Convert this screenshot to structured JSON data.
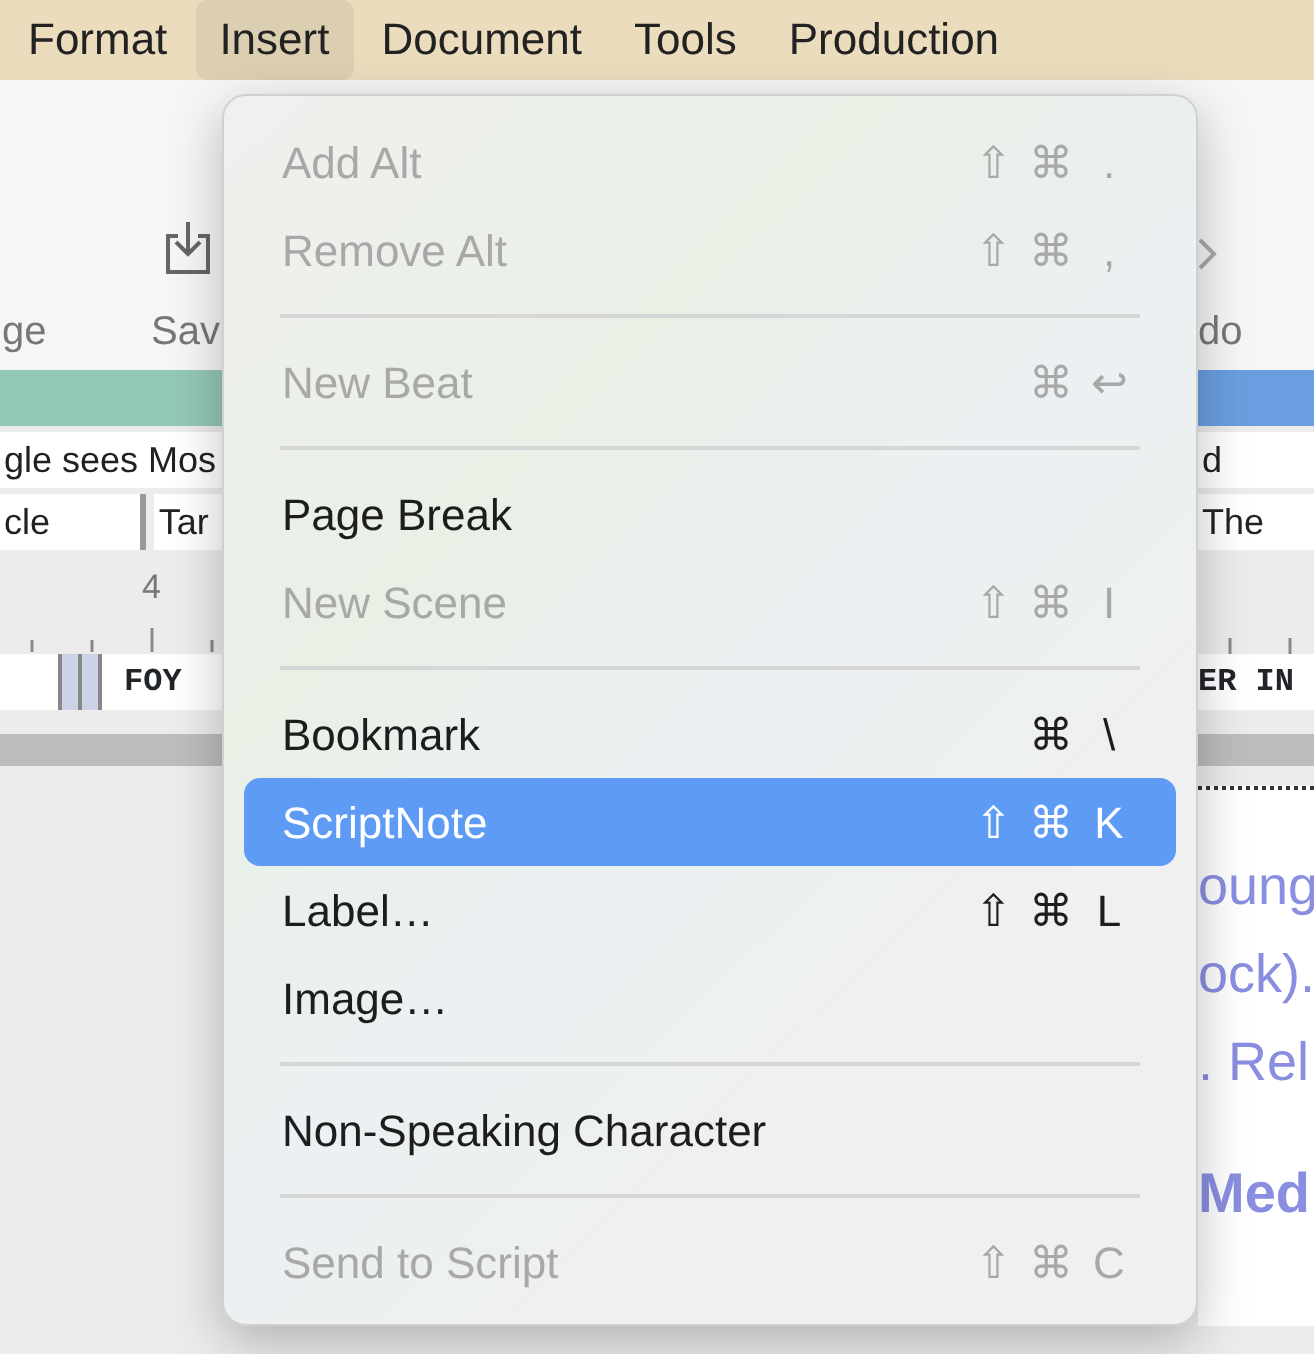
{
  "menu_bar": [
    {
      "label": "Format",
      "selected": false
    },
    {
      "label": "Insert",
      "selected": true
    },
    {
      "label": "Document",
      "selected": false
    },
    {
      "label": "Tools",
      "selected": false
    },
    {
      "label": "Production",
      "selected": false
    }
  ],
  "toolbar": {
    "left_labels": [
      "ge",
      "Sav"
    ],
    "right_label": "do"
  },
  "background": {
    "row_1": {
      "left": "gle sees Mos",
      "right": "d"
    },
    "row_2": {
      "left": [
        "cle",
        "Tar"
      ],
      "right": "The"
    },
    "ruler_number": "4",
    "script_row": {
      "left": "FOY",
      "right": "ER IN"
    },
    "document_lines": [
      "oung",
      "ock).",
      ". Rel"
    ],
    "document_heading": "Med"
  },
  "dropdown": [
    {
      "kind": "item",
      "label": "Add Alt",
      "shortcut": [
        "⇧",
        "⌘",
        "."
      ],
      "disabled": true,
      "selected": false
    },
    {
      "kind": "item",
      "label": "Remove Alt",
      "shortcut": [
        "⇧",
        "⌘",
        ","
      ],
      "disabled": true,
      "selected": false
    },
    {
      "kind": "separator"
    },
    {
      "kind": "item",
      "label": "New Beat",
      "shortcut": [
        "⌘",
        "↩"
      ],
      "disabled": true,
      "selected": false
    },
    {
      "kind": "separator"
    },
    {
      "kind": "item",
      "label": "Page Break",
      "disabled": false,
      "selected": false
    },
    {
      "kind": "item",
      "label": "New Scene",
      "shortcut": [
        "⇧",
        "⌘",
        "I"
      ],
      "disabled": true,
      "selected": false
    },
    {
      "kind": "separator"
    },
    {
      "kind": "item",
      "label": "Bookmark",
      "shortcut": [
        "⌘",
        "\\"
      ],
      "disabled": false,
      "selected": false
    },
    {
      "kind": "item",
      "label": "ScriptNote",
      "shortcut": [
        "⇧",
        "⌘",
        "K"
      ],
      "disabled": false,
      "selected": true
    },
    {
      "kind": "item",
      "label": "Label…",
      "shortcut": [
        "⇧",
        "⌘",
        "L"
      ],
      "disabled": false,
      "selected": false
    },
    {
      "kind": "item",
      "label": "Image…",
      "disabled": false,
      "selected": false
    },
    {
      "kind": "separator"
    },
    {
      "kind": "item",
      "label": "Non-Speaking Character",
      "disabled": false,
      "selected": false
    },
    {
      "kind": "separator"
    },
    {
      "kind": "item",
      "label": "Send to Script",
      "shortcut": [
        "⇧",
        "⌘",
        "C"
      ],
      "disabled": true,
      "selected": false
    }
  ]
}
